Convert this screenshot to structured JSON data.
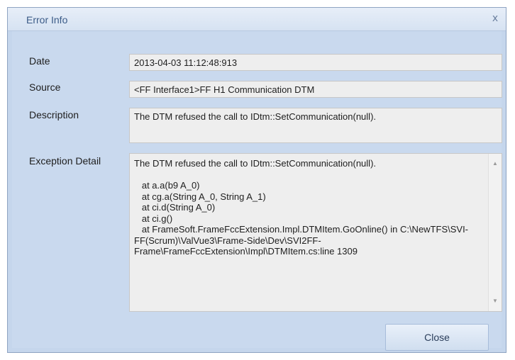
{
  "window": {
    "title": "Error Info",
    "close_glyph": "x"
  },
  "fields": {
    "date": {
      "label": "Date",
      "value": "2013-04-03 11:12:48:913"
    },
    "source": {
      "label": "Source",
      "value": "<FF Interface1>FF H1 Communication DTM"
    },
    "description": {
      "label": "Description",
      "value": "The DTM refused the call to IDtm::SetCommunication(null)."
    },
    "exception_detail": {
      "label": "Exception Detail",
      "value": "The DTM refused the call to IDtm::SetCommunication(null).\n\n   at a.a(b9 A_0)\n   at cg.a(String A_0, String A_1)\n   at ci.d(String A_0)\n   at ci.g()\n   at FrameSoft.FrameFccExtension.Impl.DTMItem.GoOnline() in C:\\NewTFS\\SVI-FF(Scrum)\\ValVue3\\Frame-Side\\Dev\\SVI2FF-Frame\\FrameFccExtension\\Impl\\DTMItem.cs:line 1309"
    }
  },
  "scrollbar": {
    "up_icon": "▲",
    "down_icon": "▼"
  },
  "buttons": {
    "close_label": "Close"
  }
}
